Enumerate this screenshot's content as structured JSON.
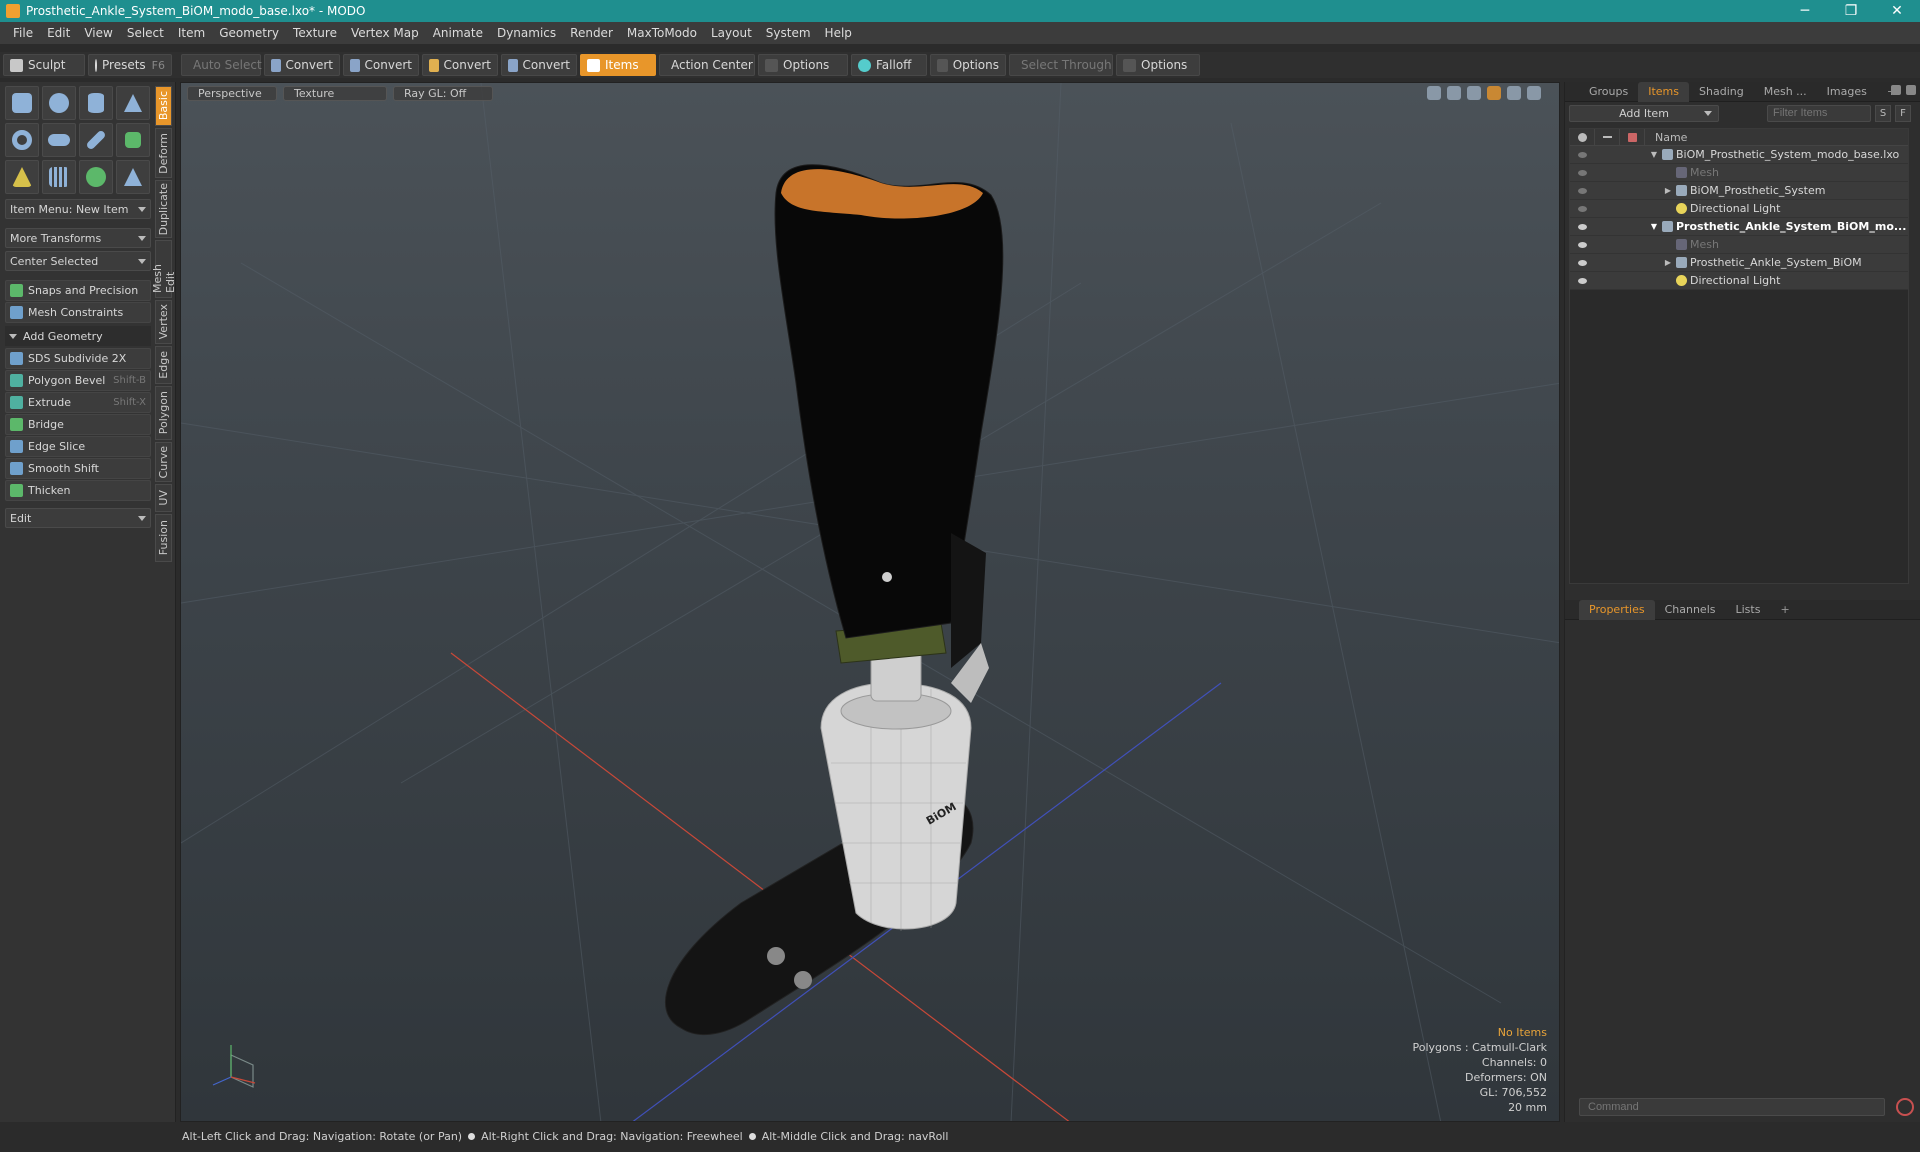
{
  "window": {
    "title": "Prosthetic_Ankle_System_BiOM_modo_base.lxo* - MODO",
    "controls": [
      "─",
      "❐",
      "✕"
    ]
  },
  "menu": [
    "File",
    "Edit",
    "View",
    "Select",
    "Item",
    "Geometry",
    "Texture",
    "Vertex Map",
    "Animate",
    "Dynamics",
    "Render",
    "MaxToModo",
    "Layout",
    "System",
    "Help"
  ],
  "toolbar": {
    "sculpt": "Sculpt",
    "presets": "Presets",
    "presets_key": "F6",
    "auto_select": "Auto Select",
    "convert1": "Convert",
    "convert2": "Convert",
    "convert3": "Convert",
    "convert4": "Convert",
    "items": "Items",
    "action_center": "Action Center",
    "options1": "Options",
    "falloff": "Falloff",
    "options2": "Options",
    "select_through": "Select Through",
    "options3": "Options"
  },
  "left_panel": {
    "item_menu": "Item Menu: New Item",
    "more_transforms": "More Transforms",
    "center_selected": "Center Selected",
    "snaps": "Snaps and Precision",
    "mesh_constraints": "Mesh Constraints",
    "add_geometry": "Add Geometry",
    "tools": [
      {
        "label": "SDS Subdivide 2X",
        "key": ""
      },
      {
        "label": "Polygon Bevel",
        "key": "Shift-B"
      },
      {
        "label": "Extrude",
        "key": "Shift-X"
      },
      {
        "label": "Bridge",
        "key": ""
      },
      {
        "label": "Edge Slice",
        "key": ""
      },
      {
        "label": "Smooth Shift",
        "key": ""
      },
      {
        "label": "Thicken",
        "key": ""
      }
    ],
    "edit_dropdown": "Edit",
    "vertical_tabs": [
      "Basic",
      "Deform",
      "Duplicate",
      "Mesh Edit",
      "Vertex",
      "Edge",
      "Polygon",
      "Curve",
      "UV",
      "Fusion"
    ]
  },
  "viewport": {
    "tabs": [
      "Perspective",
      "Texture",
      "Ray GL: Off"
    ],
    "label_biom": "BiOM",
    "info": {
      "selection": "No Items",
      "polygons": "Polygons : Catmull-Clark",
      "channels": "Channels: 0",
      "deformers": "Deformers: ON",
      "gl": "GL: 706,552",
      "scale": "20 mm"
    }
  },
  "right_panel": {
    "tabs": [
      "Groups",
      "Items",
      "Shading",
      "Mesh ...",
      "Images",
      "+"
    ],
    "add_item": "Add Item",
    "filter_placeholder": "Filter Items",
    "s_btn": "S",
    "f_btn": "F",
    "name_col": "Name",
    "tree": [
      {
        "label": "BiOM_Prosthetic_System_modo_base.lxo",
        "level": 0,
        "expanded": true,
        "eye": false,
        "style": "normal"
      },
      {
        "label": "Mesh",
        "level": 1,
        "expanded": false,
        "eye": false,
        "style": "dim"
      },
      {
        "label": "BiOM_Prosthetic_System",
        "level": 1,
        "expanded": false,
        "eye": false,
        "style": "normal"
      },
      {
        "label": "Directional Light",
        "level": 1,
        "expanded": false,
        "eye": false,
        "style": "normal"
      },
      {
        "label": "Prosthetic_Ankle_System_BiOM_mo...",
        "level": 0,
        "expanded": true,
        "eye": true,
        "style": "bold"
      },
      {
        "label": "Mesh",
        "level": 1,
        "expanded": false,
        "eye": true,
        "style": "dim"
      },
      {
        "label": "Prosthetic_Ankle_System_BiOM",
        "level": 1,
        "expanded": false,
        "eye": true,
        "style": "normal"
      },
      {
        "label": "Directional Light",
        "level": 1,
        "expanded": false,
        "eye": true,
        "style": "normal"
      }
    ],
    "props_tabs": [
      "Properties",
      "Channels",
      "Lists",
      "+"
    ],
    "command_placeholder": "Command"
  },
  "status_bar": [
    "Alt-Left Click and Drag: Navigation: Rotate (or Pan)",
    "Alt-Right Click and Drag: Navigation: Freewheel",
    "Alt-Middle Click and Drag: navRoll"
  ],
  "colors": {
    "accent": "#e8962a",
    "titlebar": "#1f8f8f",
    "socket_orange": "#c8742a",
    "adapter_green": "#4e5a2a"
  }
}
